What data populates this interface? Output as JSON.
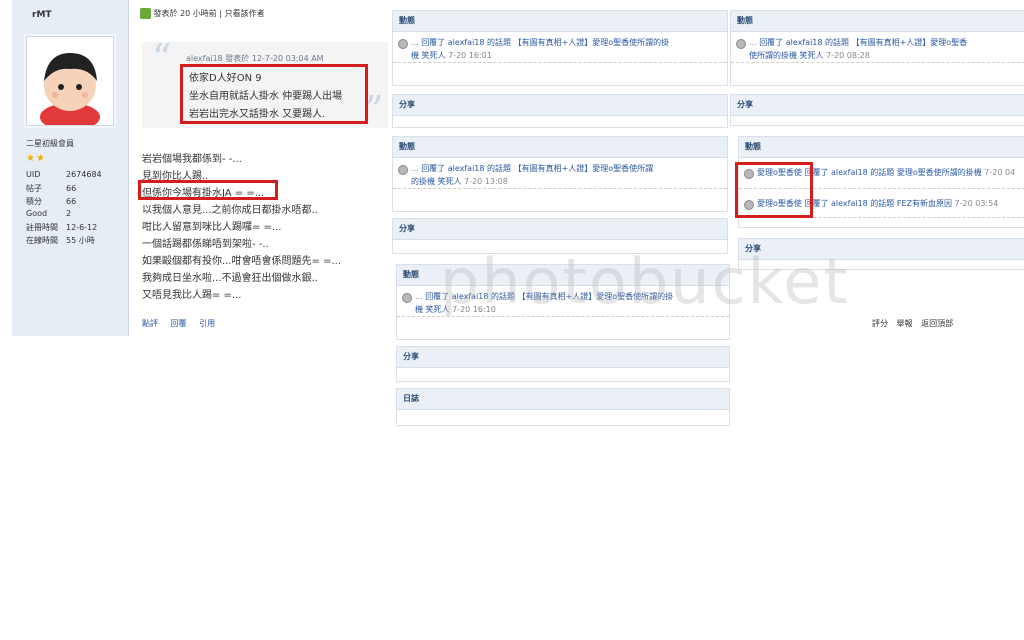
{
  "sidebar": {
    "username": "rMT",
    "rank": "二星初級會員",
    "stars": "★★",
    "stats": [
      {
        "k": "UID",
        "v": "2674684"
      },
      {
        "k": "帖子",
        "v": "66"
      },
      {
        "k": "積分",
        "v": "66"
      },
      {
        "k": "Good",
        "v": "2"
      },
      {
        "k": "註冊時間",
        "v": "12-6-12"
      },
      {
        "k": "在線時間",
        "v": "55 小時"
      }
    ]
  },
  "post": {
    "header_time": "發表於 20 小時前",
    "header_sep": "|",
    "header_author_only": "只看該作者",
    "quote_head": "alexfai18 發表於 12-7-20 03:04 AM",
    "quote_lines": [
      "依家D人好ON 9",
      "坐水自用就話人掛水 仲要踢人出場",
      "岩岩出完水又話掛水 又要踢人."
    ],
    "body_lines": [
      "岩岩個場我都係到- -...",
      "見到你比人踢..",
      "但係你今場有掛水JA = =...",
      "以我個人意見...之前你成日都掛水唔都..",
      "咁比人留意到咪比人踢囉= =...",
      "一個話踢都係睇唔到架啦- -..",
      "如果毆個都有投你...咁會唔會係問題先= =...",
      "我夠成日坐水啦...不過會狂出個做水銀..",
      "又唔見我比人踢= =..."
    ],
    "actions": [
      "點評",
      "回覆",
      "引用"
    ]
  },
  "panels": {
    "dongtai": "動態",
    "fenxiang": "分享",
    "rizhi": "日誌"
  },
  "feeds": {
    "a": {
      "user": "...",
      "text": "回覆了 alexfai18 的話題 【有圖有真相+人證】愛理o聖香使所謂的掛",
      "text2": "機 笑死人",
      "date": "7-20 16:01"
    },
    "b": {
      "user": "...",
      "text": "回覆了 alexfai18 的話題 【有圖有真相+人證】愛理o聖香",
      "text2": "使所謂的掛機 笑死人",
      "date": "7-20 08:28"
    },
    "c": {
      "user": "...",
      "text": "回覆了 alexfai18 的話題 【有圖有真相+人證】愛理o聖香使所謂",
      "text2": "的掛機 笑死人",
      "date": "7-20 13:08"
    },
    "d": {
      "user": "愛理o聖香使",
      "text": "回覆了 alexfai18 的話題 愛理o聖香使所謂的掛機",
      "date": "7-20 04"
    },
    "e": {
      "user": "愛理o聖香使",
      "text": "回覆了 alexfai18 的話題 FEZ有新血原因",
      "date": "7-20 03:54"
    },
    "f": {
      "user": "...",
      "text": "回覆了 alexfai18 的話題 【有圖有真相+人證】愛理o聖香使所謂的掛",
      "text2": "機 笑死人",
      "date": "7-20 16:10"
    }
  },
  "watermark": "photobucket",
  "footer": [
    "評分",
    "舉報",
    "返回頂部"
  ]
}
